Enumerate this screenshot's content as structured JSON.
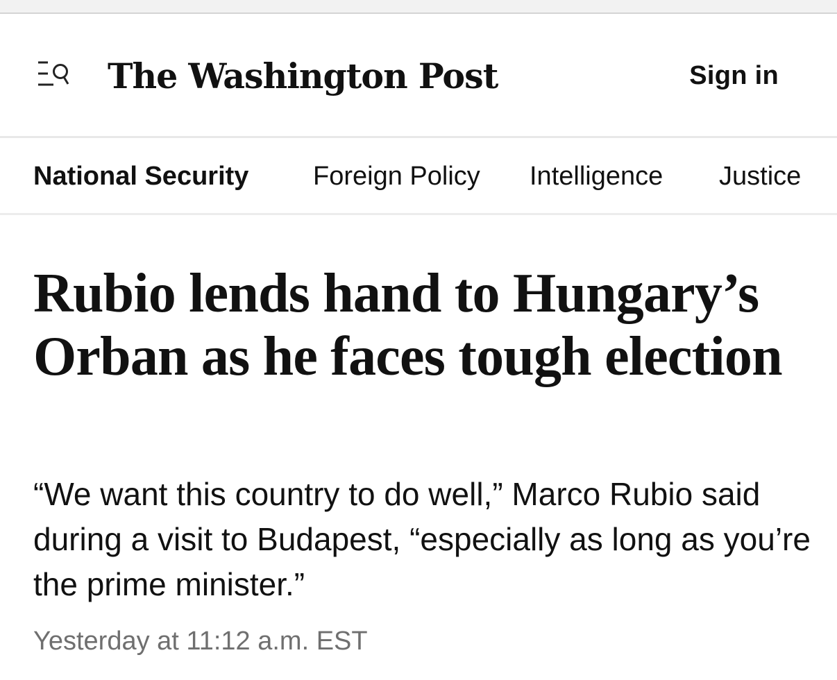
{
  "header": {
    "menu_icon": "menu-search-icon",
    "masthead": "The Washington Post",
    "sign_in_label": "Sign in"
  },
  "subnav": {
    "items": [
      {
        "label": "National Security",
        "active": true
      },
      {
        "label": "Foreign Policy",
        "active": false
      },
      {
        "label": "Intelligence",
        "active": false
      },
      {
        "label": "Justice",
        "active": false
      }
    ]
  },
  "article": {
    "headline": "Rubio lends hand to Hungary’s Orban as he faces tough election",
    "dek": "“We want this country to do well,” Marco Rubio said during a visit to Budapest, “especially as long as you’re the prime minister.”",
    "timestamp": "Yesterday at 11:12 a.m. EST"
  },
  "colors": {
    "text": "#111111",
    "timestamp": "#6f6f6f",
    "divider": "#e8e8e8",
    "background": "#ffffff"
  }
}
